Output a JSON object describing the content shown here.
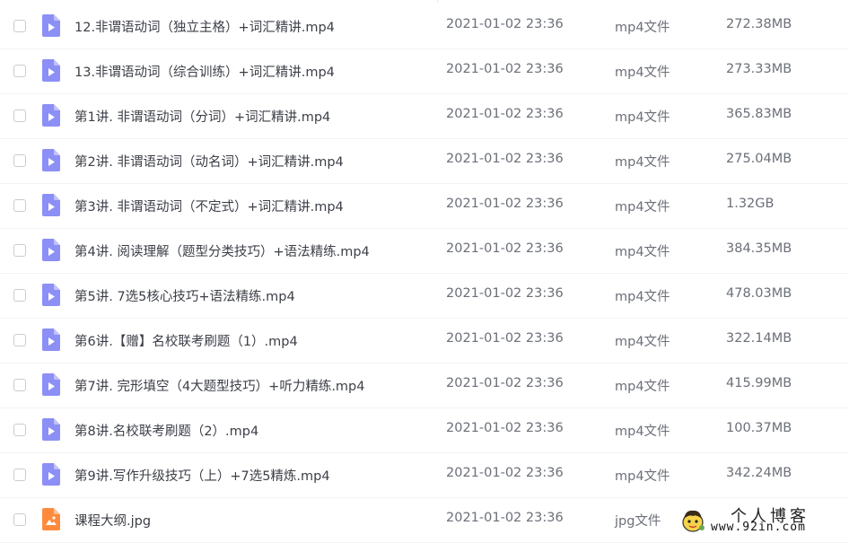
{
  "files": [
    {
      "name": "12.非谓语动词（独立主格）+词汇精讲.mp4",
      "date": "2021-01-02 23:36",
      "type": "mp4文件",
      "size": "272.38MB",
      "icon": "video-file-icon"
    },
    {
      "name": "13.非谓语动词（综合训练）+词汇精讲.mp4",
      "date": "2021-01-02 23:36",
      "type": "mp4文件",
      "size": "273.33MB",
      "icon": "video-file-icon"
    },
    {
      "name": "第1讲. 非谓语动词（分词）+词汇精讲.mp4",
      "date": "2021-01-02 23:36",
      "type": "mp4文件",
      "size": "365.83MB",
      "icon": "video-file-icon"
    },
    {
      "name": "第2讲. 非谓语动词（动名词）+词汇精讲.mp4",
      "date": "2021-01-02 23:36",
      "type": "mp4文件",
      "size": "275.04MB",
      "icon": "video-file-icon"
    },
    {
      "name": "第3讲. 非谓语动词（不定式）+词汇精讲.mp4",
      "date": "2021-01-02 23:36",
      "type": "mp4文件",
      "size": "1.32GB",
      "icon": "video-file-icon"
    },
    {
      "name": "第4讲. 阅读理解（题型分类技巧）+语法精练.mp4",
      "date": "2021-01-02 23:36",
      "type": "mp4文件",
      "size": "384.35MB",
      "icon": "video-file-icon"
    },
    {
      "name": "第5讲. 7选5核心技巧+语法精练.mp4",
      "date": "2021-01-02 23:36",
      "type": "mp4文件",
      "size": "478.03MB",
      "icon": "video-file-icon"
    },
    {
      "name": "第6讲.【赠】名校联考刷题（1）.mp4",
      "date": "2021-01-02 23:36",
      "type": "mp4文件",
      "size": "322.14MB",
      "icon": "video-file-icon"
    },
    {
      "name": "第7讲. 完形填空（4大题型技巧）+听力精练.mp4",
      "date": "2021-01-02 23:36",
      "type": "mp4文件",
      "size": "415.99MB",
      "icon": "video-file-icon"
    },
    {
      "name": "第8讲.名校联考刷题（2）.mp4",
      "date": "2021-01-02 23:36",
      "type": "mp4文件",
      "size": "100.37MB",
      "icon": "video-file-icon"
    },
    {
      "name": "第9讲.写作升级技巧（上）+7选5精炼.mp4",
      "date": "2021-01-02 23:36",
      "type": "mp4文件",
      "size": "342.24MB",
      "icon": "video-file-icon"
    },
    {
      "name": "课程大纲.jpg",
      "date": "2021-01-02 23:36",
      "type": "jpg文件",
      "size": "",
      "icon": "image-file-icon"
    }
  ],
  "colors": {
    "video_icon": "#8c8ff5",
    "image_icon": "#ff8a3d"
  },
  "watermark": {
    "title": "个人博客",
    "url": "www.92in.com"
  }
}
